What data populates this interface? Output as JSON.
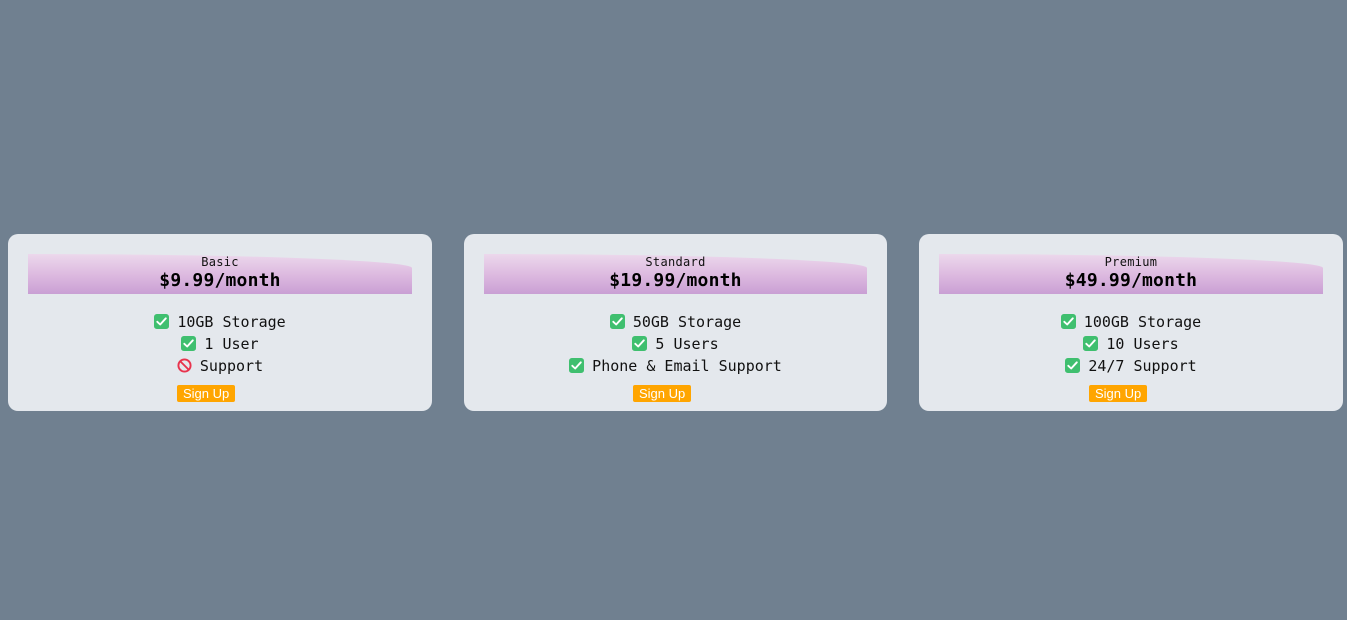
{
  "plans": [
    {
      "name": "Basic",
      "price": "$9.99/month",
      "features": [
        {
          "text": "10GB Storage",
          "included": true
        },
        {
          "text": "1 User",
          "included": true
        },
        {
          "text": "Support",
          "included": false
        }
      ],
      "button_label": "Sign Up"
    },
    {
      "name": "Standard",
      "price": "$19.99/month",
      "features": [
        {
          "text": "50GB Storage",
          "included": true
        },
        {
          "text": "5 Users",
          "included": true
        },
        {
          "text": "Phone & Email Support",
          "included": true
        }
      ],
      "button_label": "Sign Up"
    },
    {
      "name": "Premium",
      "price": "$49.99/month",
      "features": [
        {
          "text": "100GB Storage",
          "included": true
        },
        {
          "text": "10 Users",
          "included": true
        },
        {
          "text": "24/7 Support",
          "included": true
        }
      ],
      "button_label": "Sign Up"
    }
  ],
  "colors": {
    "background": "#708090",
    "card": "#e4e8ed",
    "button": "#ffa500",
    "check": "#3fbf6f",
    "prohibited": "#e8334d"
  },
  "icons": {
    "included": "check-mark-icon",
    "excluded": "prohibited-icon"
  }
}
